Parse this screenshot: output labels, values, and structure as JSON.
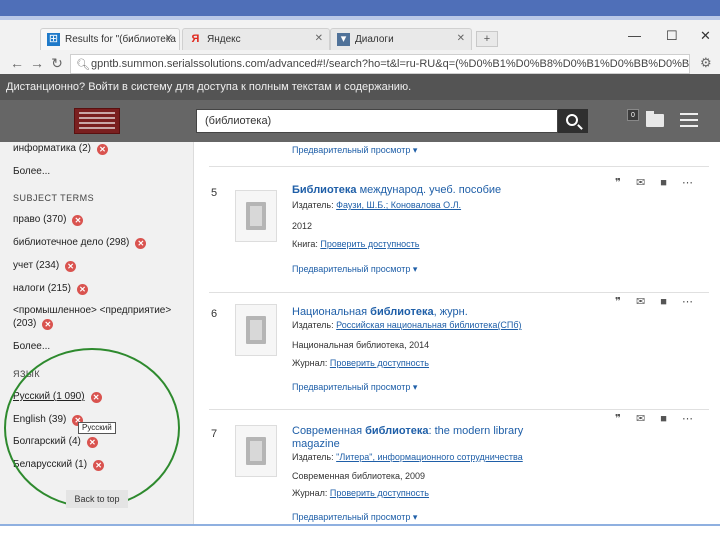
{
  "browser": {
    "tabs": [
      {
        "label": "Results for \"(библиотека",
        "icon": "summon"
      },
      {
        "label": "Яндекс",
        "icon": "yandex"
      },
      {
        "label": "Диалоги",
        "icon": "vk"
      }
    ],
    "new_tab": "+",
    "window_controls": {
      "minimize": "—",
      "maximize": "☐",
      "close": "✕"
    },
    "url": "gpntb.summon.serialssolutions.com/advanced#!/search?ho=t&l=ru-RU&q=(%D0%B1%D0%B8%D0%B1%D0%BB%D0%B8%D0%BE"
  },
  "banner": {
    "text": "Дистанционно? Войти в систему для доступа к полным текстам и содержанию."
  },
  "header": {
    "search_value": "(библиотека)",
    "badge": "0"
  },
  "sidebar": {
    "top_item": "информатика (2)",
    "more1": "Более...",
    "subjects_heading": "SUBJECT TERMS",
    "subjects": [
      {
        "label": "право (370)"
      },
      {
        "label": "библиотечное дело (298)"
      },
      {
        "label": "учет (234)"
      },
      {
        "label": "налоги (215)"
      },
      {
        "label": "<промышленное> <предприятие>",
        "label2": "(203)"
      }
    ],
    "more2": "Более...",
    "lang_heading": "ЯЗЫК",
    "languages": [
      {
        "label": "Русский (1 090)"
      },
      {
        "label": "English (39)"
      },
      {
        "label": "Болгарский (4)"
      },
      {
        "label": "Беларусский (1)"
      }
    ],
    "tooltip": "Русский",
    "back_to_top": "Back to top"
  },
  "results": {
    "preview_label": "Предварительный просмотр ▾",
    "items": [
      {
        "num": "5",
        "title_bold": "Библиотека",
        "title_rest": " международ. учеб. пособие",
        "publisher_label": "Издатель: ",
        "publisher": "Фаузи, Ш.Б.; Коновалова О.Л.",
        "year": "2012",
        "kind_label": "Книга: ",
        "check": "Проверить доступность"
      },
      {
        "num": "6",
        "title_pre": "Национальная ",
        "title_bold": "библиотека",
        "title_rest": ", журн.",
        "publisher_label": "Издатель: ",
        "publisher": "Российская национальная библиотека(СПб)",
        "year": "Национальная библиотека, 2014",
        "kind_label": "Журнал: ",
        "check": "Проверить доступность"
      },
      {
        "num": "7",
        "title_pre": "Современная ",
        "title_bold": "библиотека",
        "title_rest": ": the modern library",
        "title_line2": "magazine",
        "publisher_label": "Издатель: ",
        "publisher": "\"Литера\", информационного сотрудничества",
        "year": "Современная библиотека, 2009",
        "kind_label": "Журнал: ",
        "check": "Проверить доступность"
      }
    ],
    "actions": "❞ ✉ ■ ⋯"
  },
  "colors": {
    "accent": "#1f5fa8",
    "remove": "#d9534f",
    "circle": "#2e8a2e",
    "header": "#666666"
  }
}
